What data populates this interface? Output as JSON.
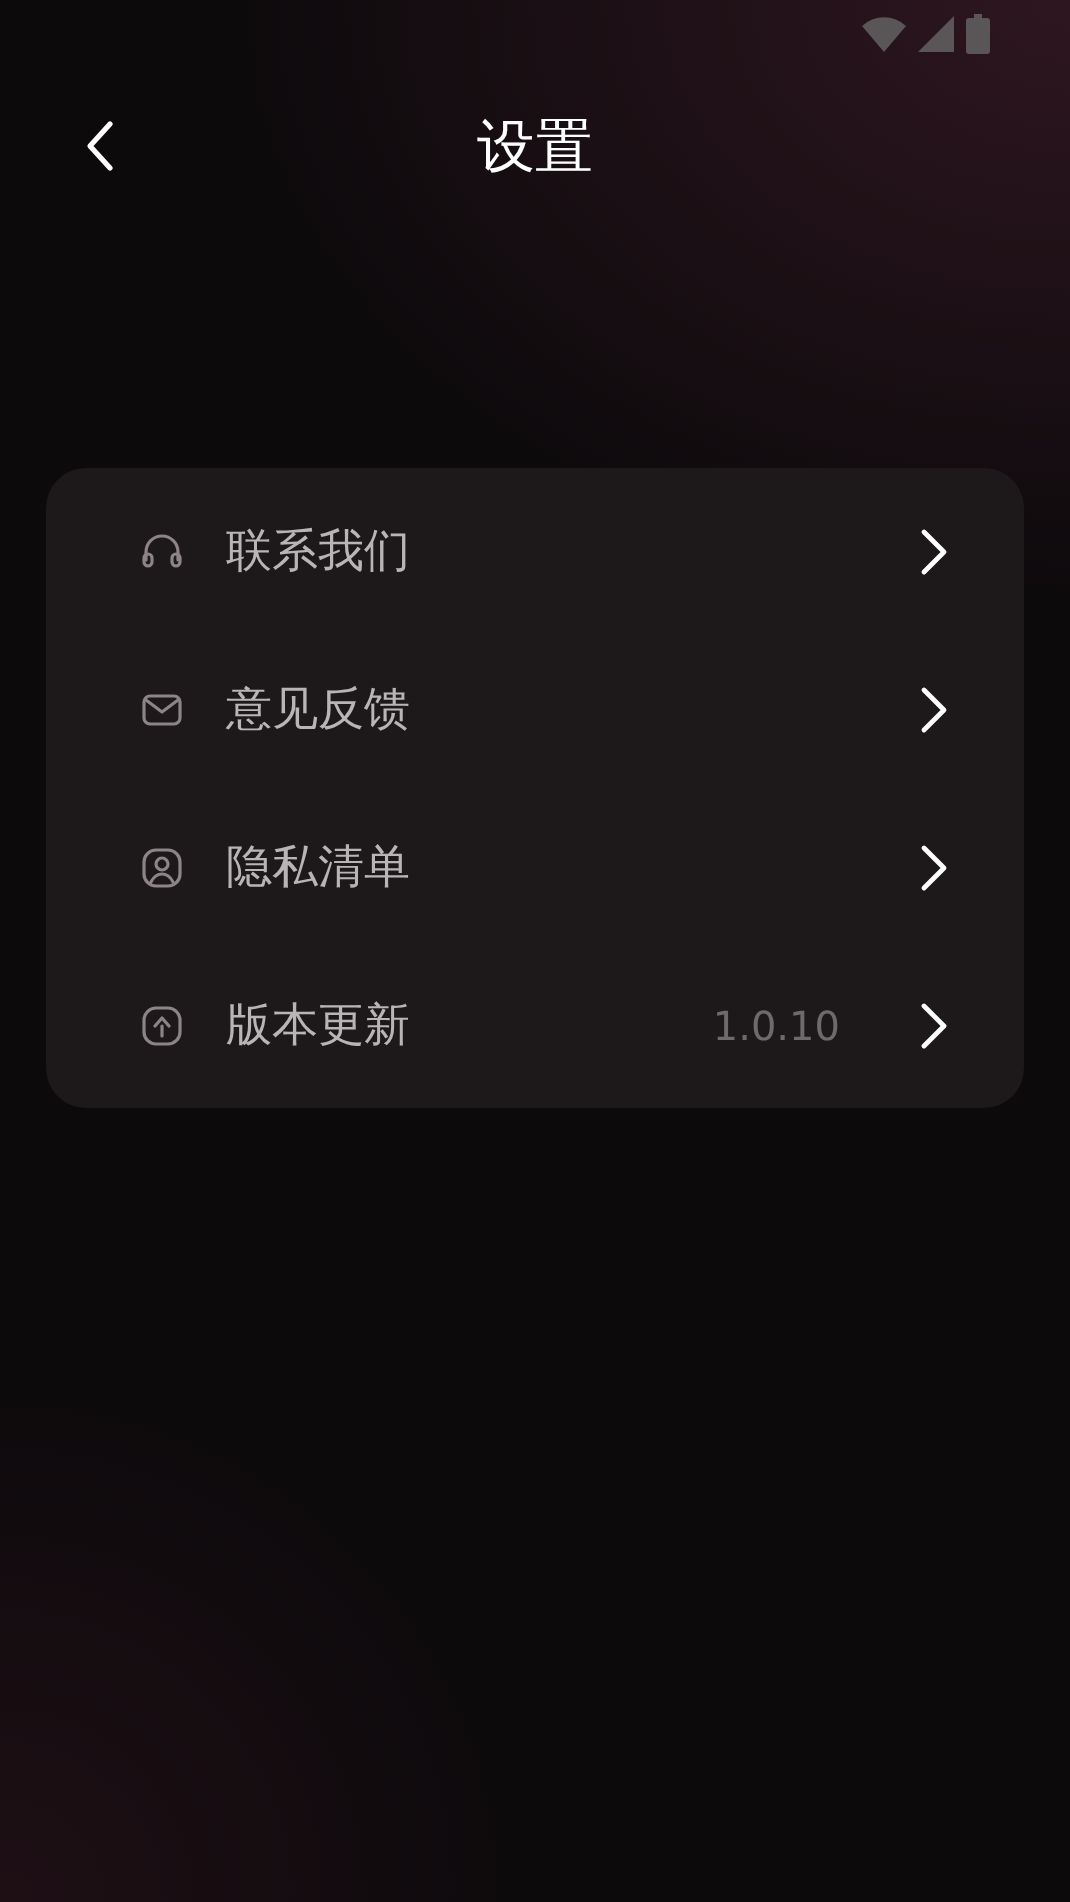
{
  "header": {
    "title": "设置"
  },
  "settings": [
    {
      "label": "联系我们"
    },
    {
      "label": "意见反馈"
    },
    {
      "label": "隐私清单"
    },
    {
      "label": "版本更新",
      "value": "1.0.10"
    }
  ]
}
